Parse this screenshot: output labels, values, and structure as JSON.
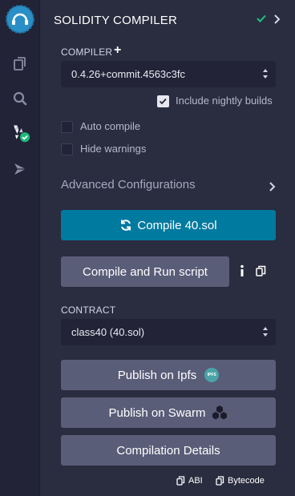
{
  "sidebar": {
    "icons": [
      "remix-logo-icon",
      "file-explorer-icon",
      "search-icon",
      "solidity-compiler-icon",
      "deploy-run-icon"
    ],
    "colors": {
      "rail_bg": "#222336",
      "status_green": "#1fb87a"
    }
  },
  "header": {
    "title": "SOLIDITY COMPILER"
  },
  "compiler": {
    "label": "COMPILER",
    "version": "0.4.26+commit.4563c3fc",
    "include_nightly_label": "Include nightly builds",
    "include_nightly_checked": true
  },
  "options": {
    "auto_compile_label": "Auto compile",
    "auto_compile_checked": false,
    "hide_warnings_label": "Hide warnings",
    "hide_warnings_checked": false
  },
  "advanced": {
    "label": "Advanced Configurations"
  },
  "actions": {
    "compile_label": "Compile 40.sol",
    "compile_run_label": "Compile and Run script",
    "accent": "#017aa0"
  },
  "contract": {
    "label": "CONTRACT",
    "selected": "class40 (40.sol)"
  },
  "publish": {
    "ipfs_label": "Publish on Ipfs",
    "ipfs_badge": "IPFS",
    "swarm_label": "Publish on Swarm",
    "details_label": "Compilation Details"
  },
  "footer": {
    "abi_label": "ABI",
    "bytecode_label": "Bytecode"
  }
}
